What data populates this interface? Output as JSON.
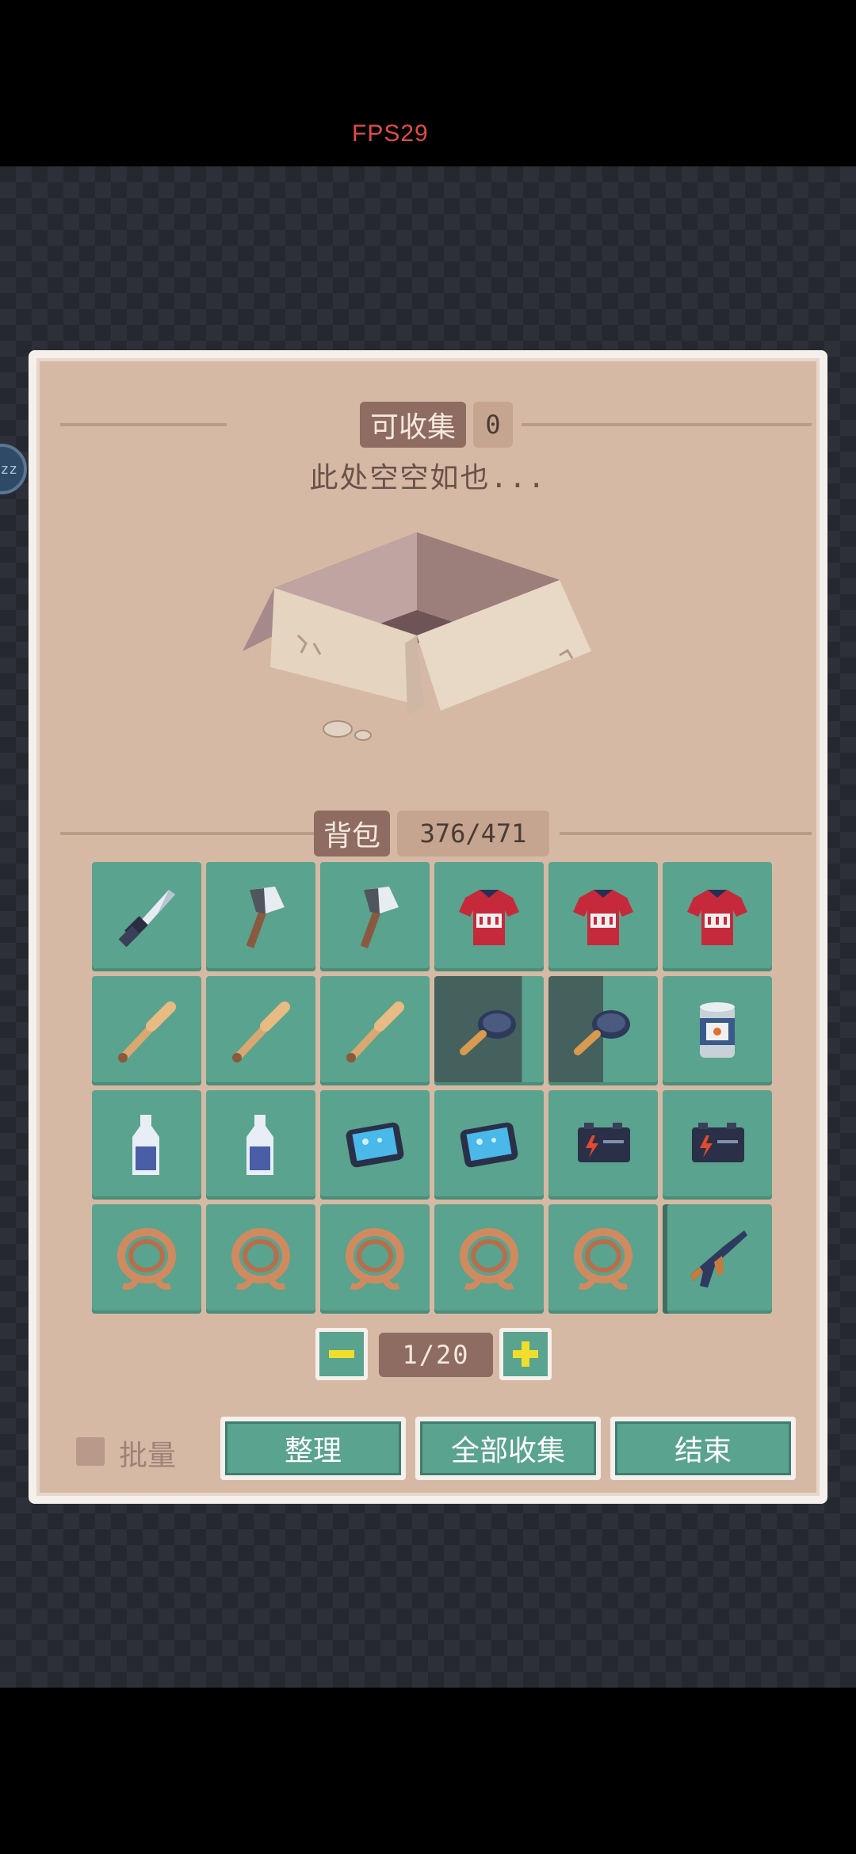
{
  "hud": {
    "fps": "FPS29",
    "sleep_badge": "zz"
  },
  "collect": {
    "title": "可收集",
    "count": "0",
    "empty_message": "此处空空如也..."
  },
  "backpack": {
    "title": "背包",
    "capacity": "376/471"
  },
  "items": [
    {
      "icon": "knife-icon"
    },
    {
      "icon": "axe-icon"
    },
    {
      "icon": "axe-icon"
    },
    {
      "icon": "red-shirt-icon"
    },
    {
      "icon": "red-shirt-icon"
    },
    {
      "icon": "red-shirt-icon"
    },
    {
      "icon": "baseball-bat-icon"
    },
    {
      "icon": "baseball-bat-icon"
    },
    {
      "icon": "baseball-bat-icon"
    },
    {
      "icon": "frying-pan-icon",
      "progress": 0.2
    },
    {
      "icon": "frying-pan-icon",
      "progress": 0.5
    },
    {
      "icon": "canned-food-icon"
    },
    {
      "icon": "water-bottle-icon"
    },
    {
      "icon": "water-bottle-icon"
    },
    {
      "icon": "tablet-icon"
    },
    {
      "icon": "tablet-icon"
    },
    {
      "icon": "battery-icon"
    },
    {
      "icon": "battery-icon"
    },
    {
      "icon": "rope-icon"
    },
    {
      "icon": "rope-icon"
    },
    {
      "icon": "rope-icon"
    },
    {
      "icon": "rope-icon"
    },
    {
      "icon": "rope-icon"
    },
    {
      "icon": "rifle-icon"
    }
  ],
  "pager": {
    "page": "1/20",
    "minus_icon": "minus-icon",
    "plus_icon": "plus-icon"
  },
  "footer": {
    "batch_label": "批量",
    "sort_label": "整理",
    "collect_all_label": "全部收集",
    "end_label": "结束"
  },
  "colors": {
    "slot": "#5aa38e",
    "panel": "#d5b9a5",
    "tag": "#8e6c61",
    "fps": "#e04a4a"
  }
}
